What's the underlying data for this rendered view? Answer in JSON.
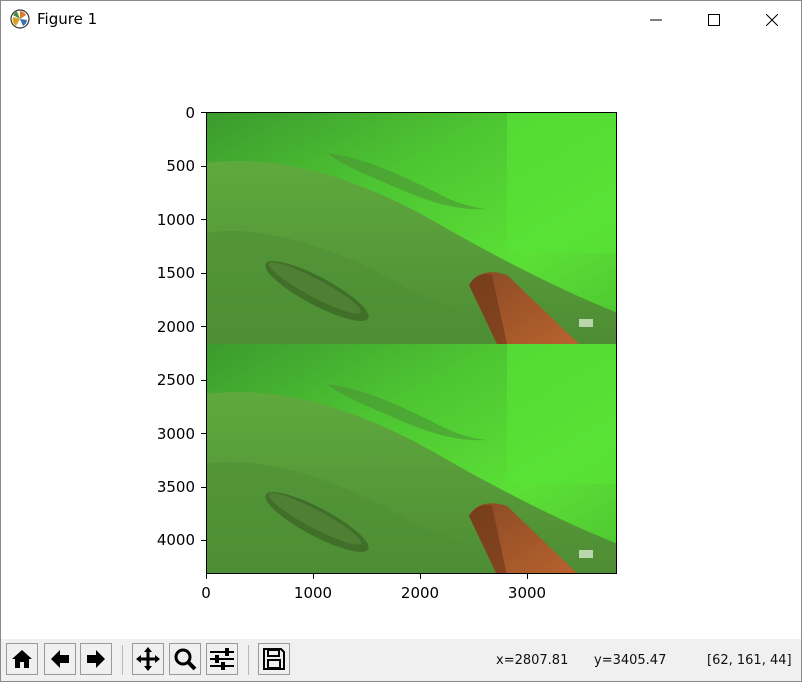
{
  "window": {
    "title": "Figure 1",
    "icons": {
      "app": "matplotlib-logo-icon",
      "minimize": "minimize-icon",
      "maximize": "maximize-icon",
      "close": "close-icon"
    }
  },
  "figure": {
    "image_description_colors": {
      "water": "#4fd033",
      "seabed": "#5aa83c",
      "board": "#a0562a"
    },
    "y_ticks": [
      "0",
      "500",
      "1000",
      "1500",
      "2000",
      "2500",
      "3000",
      "3500",
      "4000"
    ],
    "x_ticks": [
      "0",
      "1000",
      "2000",
      "3000"
    ]
  },
  "toolbar": {
    "buttons": [
      {
        "name": "home-button",
        "icon": "home-icon"
      },
      {
        "name": "back-button",
        "icon": "arrow-left-icon"
      },
      {
        "name": "forward-button",
        "icon": "arrow-right-icon"
      },
      {
        "name": "pan-button",
        "icon": "move-icon"
      },
      {
        "name": "zoom-button",
        "icon": "magnifier-icon"
      },
      {
        "name": "configure-subplots-button",
        "icon": "sliders-icon"
      },
      {
        "name": "save-button",
        "icon": "floppy-disk-icon"
      }
    ],
    "status": {
      "x": "x=2807.81",
      "y": "y=3405.47",
      "pixel": "[62, 161, 44]"
    }
  }
}
